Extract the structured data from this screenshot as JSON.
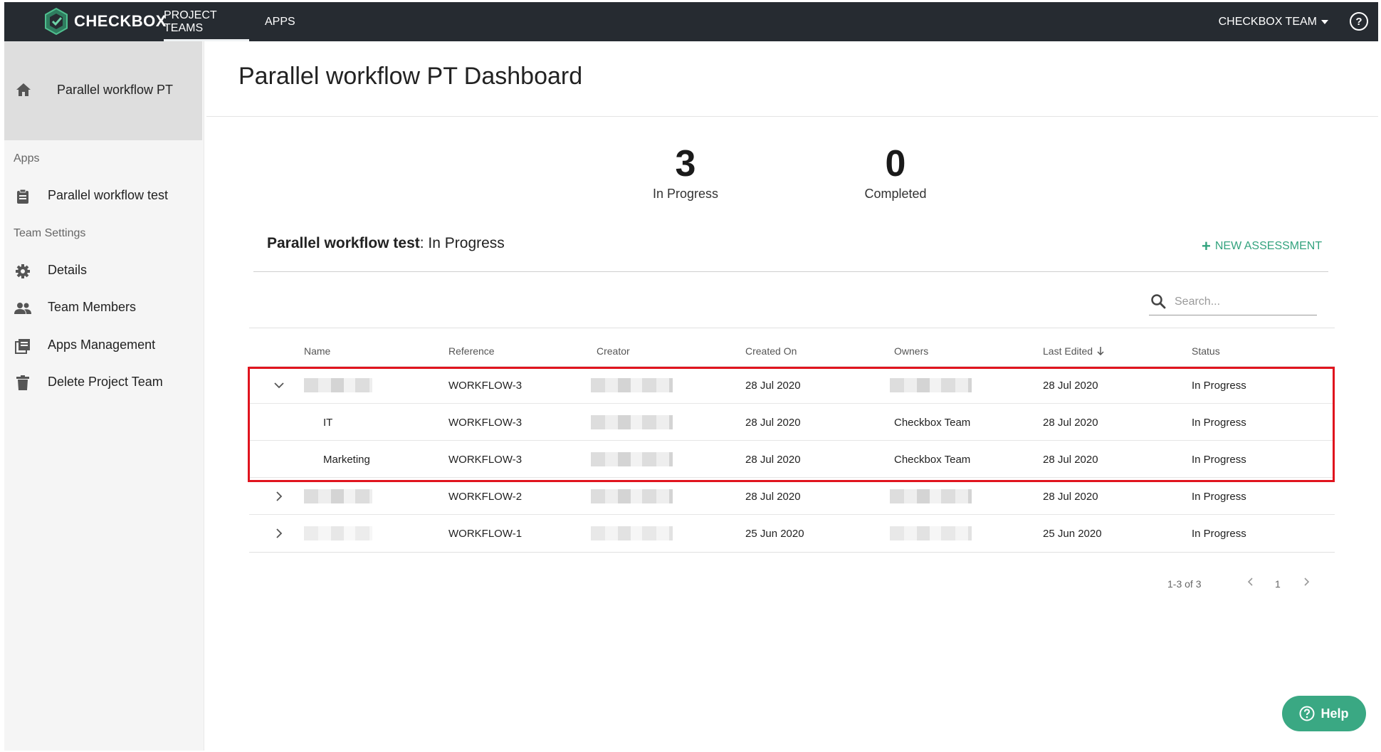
{
  "topbar": {
    "brand": "CHECKBOX",
    "tabs": [
      "PROJECT TEAMS",
      "APPS"
    ],
    "team_menu": "CHECKBOX TEAM",
    "help_glyph": "?"
  },
  "sidebar": {
    "home_label": "Parallel workflow PT",
    "apps_section": "Apps",
    "app_item": "Parallel workflow test",
    "settings_section": "Team Settings",
    "settings_items": [
      "Details",
      "Team Members",
      "Apps Management",
      "Delete Project Team"
    ]
  },
  "page": {
    "title": "Parallel workflow PT Dashboard"
  },
  "stats": [
    {
      "value": "3",
      "label": "In Progress"
    },
    {
      "value": "0",
      "label": "Completed"
    }
  ],
  "section": {
    "app_name": "Parallel workflow test",
    "status_suffix": ": In Progress",
    "new_assessment": "NEW ASSESSMENT"
  },
  "search": {
    "placeholder": "Search..."
  },
  "table": {
    "columns": [
      "Name",
      "Reference",
      "Creator",
      "Created On",
      "Owners",
      "Last Edited",
      "Status"
    ],
    "rows": [
      {
        "name": "",
        "reference": "WORKFLOW-3",
        "created_on": "28 Jul 2020",
        "owners": "",
        "last_edited": "28 Jul 2020",
        "status": "In Progress"
      },
      {
        "name": "IT",
        "reference": "WORKFLOW-3",
        "created_on": "28 Jul 2020",
        "owners": "Checkbox Team",
        "last_edited": "28 Jul 2020",
        "status": "In Progress"
      },
      {
        "name": "Marketing",
        "reference": "WORKFLOW-3",
        "created_on": "28 Jul 2020",
        "owners": "Checkbox Team",
        "last_edited": "28 Jul 2020",
        "status": "In Progress"
      },
      {
        "name": "",
        "reference": "WORKFLOW-2",
        "created_on": "28 Jul 2020",
        "owners": "",
        "last_edited": "28 Jul 2020",
        "status": "In Progress"
      },
      {
        "name": "",
        "reference": "WORKFLOW-1",
        "created_on": "25 Jun 2020",
        "owners": "",
        "last_edited": "25 Jun 2020",
        "status": "In Progress"
      }
    ]
  },
  "pagination": {
    "range": "1-3 of 3",
    "page": "1"
  },
  "help_button": {
    "label": "Help"
  },
  "colors": {
    "topbar": "#262b31",
    "accent_green": "#3aa883",
    "highlight_red": "#e0141e"
  }
}
